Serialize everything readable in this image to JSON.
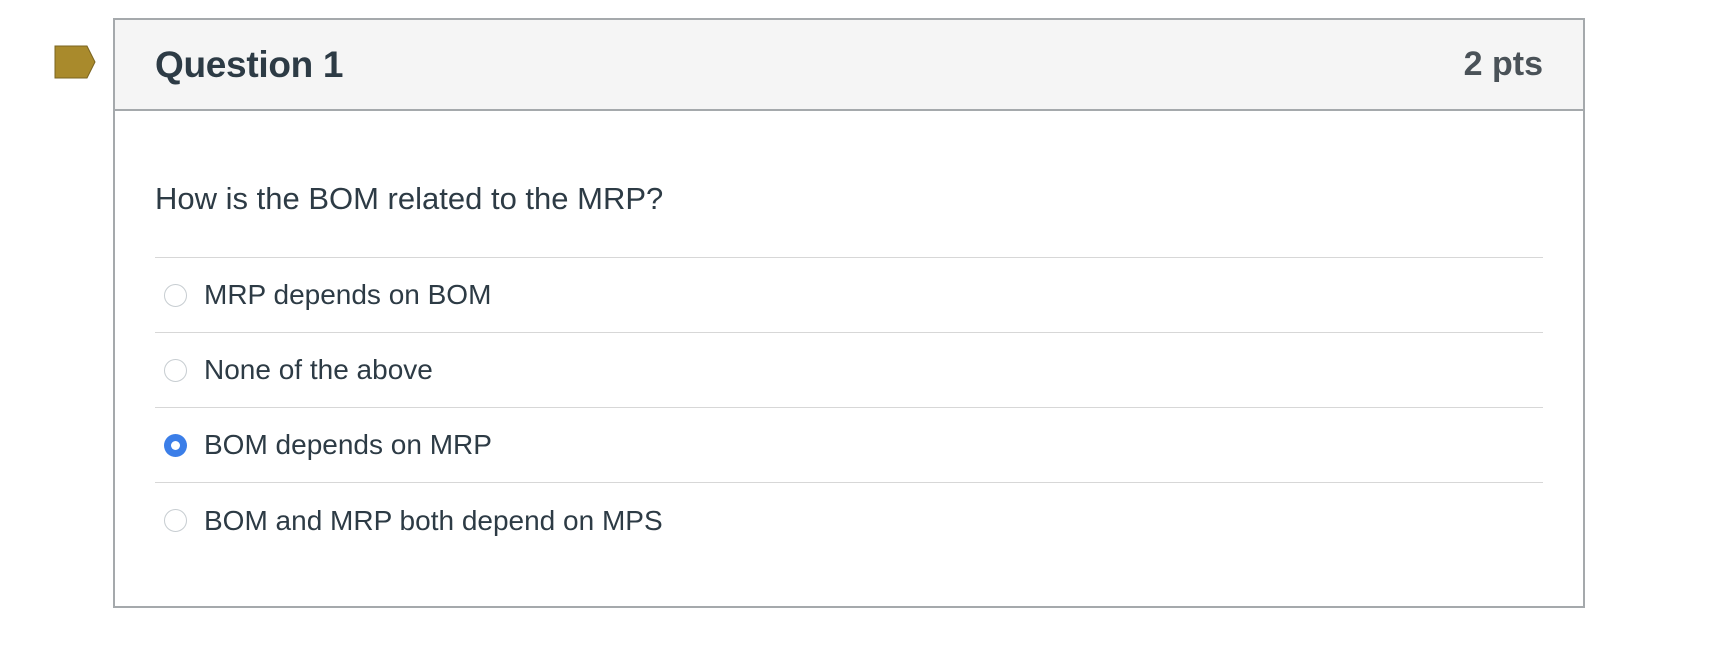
{
  "question": {
    "title": "Question 1",
    "points": "2 pts",
    "text": "How is the BOM related to the MRP?",
    "flag_icon": "flag-icon",
    "flag_color": "#a98a2c",
    "answers": [
      {
        "label": "MRP depends on BOM",
        "selected": false
      },
      {
        "label": "None of the above",
        "selected": false
      },
      {
        "label": "BOM depends on MRP",
        "selected": true
      },
      {
        "label": "BOM and MRP both depend on MPS",
        "selected": false
      }
    ]
  },
  "colors": {
    "accent": "#3b7ee8",
    "text": "#2d3b45",
    "header_bg": "#f5f5f5",
    "border": "#a5a9ac"
  }
}
